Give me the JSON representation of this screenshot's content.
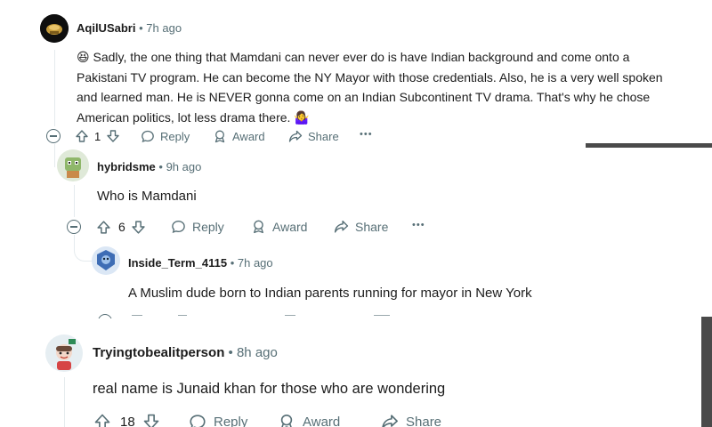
{
  "comments": [
    {
      "username": "AqilUSabri",
      "time": "7h ago",
      "emoji_start": "😆",
      "text": "Sadly, the one thing that Mamdani can never ever do is have Indian background and come onto a Pakistani TV program. He can become the NY Mayor with those credentials. Also, he is a very well spoken and learned man. He is NEVER gonna come on an Indian Subcontinent TV drama. That's why he chose American politics, lot less drama there.",
      "emoji_end": "🤷‍♀️",
      "votes": "1",
      "reply": "Reply",
      "award": "Award",
      "share": "Share",
      "more": "•••"
    },
    {
      "username": "hybridsme",
      "time": "9h ago",
      "text": "Who is Mamdani",
      "votes": "6",
      "reply": "Reply",
      "award": "Award",
      "share": "Share",
      "more": "•••"
    },
    {
      "username": "Inside_Term_4115",
      "time": "7h ago",
      "text": "A Muslim dude born to Indian parents running for mayor in New York"
    },
    {
      "username": "Tryingtobealitperson",
      "time": "8h ago",
      "text": "real name is Junaid khan for those who are wondering",
      "votes": "18",
      "reply": "Reply",
      "award": "Award",
      "share": "Share"
    }
  ],
  "separator": "•",
  "colors": {
    "meta": "#576f76",
    "text": "#1c1c1c",
    "thread": "#e5ebee",
    "right_bar": "#4a4a4a"
  },
  "icons": [
    "upvote-icon",
    "downvote-icon",
    "reply-icon",
    "award-icon",
    "share-icon",
    "collapse-icon"
  ]
}
